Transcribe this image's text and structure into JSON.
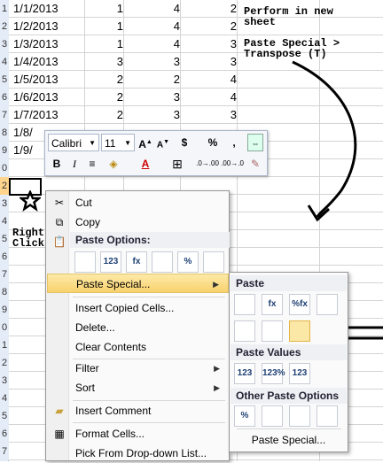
{
  "rows": [
    {
      "num": "1",
      "cells": [
        "1/1/2013",
        "1",
        "4",
        "2"
      ]
    },
    {
      "num": "2",
      "cells": [
        "1/2/2013",
        "1",
        "4",
        "2"
      ]
    },
    {
      "num": "3",
      "cells": [
        "1/3/2013",
        "1",
        "4",
        "3"
      ]
    },
    {
      "num": "4",
      "cells": [
        "1/4/2013",
        "3",
        "3",
        "3"
      ]
    },
    {
      "num": "5",
      "cells": [
        "1/5/2013",
        "2",
        "2",
        "4"
      ]
    },
    {
      "num": "6",
      "cells": [
        "1/6/2013",
        "2",
        "3",
        "4"
      ]
    },
    {
      "num": "7",
      "cells": [
        "1/7/2013",
        "2",
        "3",
        "3"
      ]
    },
    {
      "num": "8",
      "cells": [
        "1/8/",
        "",
        "",
        ""
      ]
    },
    {
      "num": "9",
      "cells": [
        "1/9/",
        "",
        "",
        ""
      ]
    },
    {
      "num": "0",
      "cells": [
        "",
        "",
        "",
        ""
      ]
    },
    {
      "num": "2",
      "cells": [
        "",
        "",
        "",
        ""
      ]
    },
    {
      "num": "3",
      "cells": [
        "",
        "",
        "",
        ""
      ]
    },
    {
      "num": "4",
      "cells": [
        "",
        "",
        "",
        ""
      ]
    },
    {
      "num": "5",
      "cells": [
        "",
        "",
        "",
        ""
      ]
    },
    {
      "num": "6",
      "cells": [
        "",
        "",
        "",
        ""
      ]
    },
    {
      "num": "7",
      "cells": [
        "",
        "",
        "",
        ""
      ]
    },
    {
      "num": "8",
      "cells": [
        "",
        "",
        "",
        ""
      ]
    },
    {
      "num": "9",
      "cells": [
        "",
        "",
        "",
        ""
      ]
    },
    {
      "num": "0",
      "cells": [
        "",
        "",
        "",
        ""
      ]
    },
    {
      "num": "1",
      "cells": [
        "",
        "",
        "",
        ""
      ]
    },
    {
      "num": "2",
      "cells": [
        "",
        "",
        "",
        ""
      ]
    },
    {
      "num": "3",
      "cells": [
        "",
        "",
        "",
        ""
      ]
    },
    {
      "num": "4",
      "cells": [
        "",
        "",
        "",
        ""
      ]
    },
    {
      "num": "5",
      "cells": [
        "",
        "",
        "",
        ""
      ]
    },
    {
      "num": "6",
      "cells": [
        "",
        "",
        "",
        ""
      ]
    },
    {
      "num": "7",
      "cells": [
        "",
        "",
        "",
        ""
      ]
    }
  ],
  "notes": {
    "perform": "Perform in new\nsheet",
    "paste_special": "Paste Special >\nTranspose (T)",
    "right_click": "Right\nClick"
  },
  "mini_toolbar": {
    "font_name": "Calibri",
    "font_size": "11",
    "grow_font": "A",
    "shrink_font": "A",
    "currency": "$",
    "percent": "%",
    "comma": ",",
    "bold": "B",
    "italic": "I",
    "font_color": "A",
    "increase_decimal": ".0→.00",
    "decrease_decimal": ".00→.0"
  },
  "context_menu": {
    "cut": "Cut",
    "copy": "Copy",
    "paste_options_header": "Paste Options:",
    "paste_special": "Paste Special...",
    "insert_copied_cells": "Insert Copied Cells...",
    "delete": "Delete...",
    "clear_contents": "Clear Contents",
    "filter": "Filter",
    "sort": "Sort",
    "insert_comment": "Insert Comment",
    "format_cells": "Format Cells...",
    "pick_from_dropdown": "Pick From Drop-down List...",
    "paste_option_icons": [
      "",
      "123",
      "fx",
      "",
      "%",
      ""
    ]
  },
  "submenu": {
    "paste_header": "Paste",
    "paste_values_header": "Paste Values",
    "other_paste_header": "Other Paste Options",
    "paste_icons_row1": [
      "",
      "fx",
      "%fx",
      ""
    ],
    "paste_icons_row2": [
      "",
      "",
      ""
    ],
    "values_icons": [
      "123",
      "123%",
      "123"
    ],
    "other_icons": [
      "%",
      "",
      "",
      ""
    ],
    "paste_special_link": "Paste Special..."
  },
  "colors": {
    "highlight": "#f8d26e",
    "header_bg": "#e4ecf7",
    "selected_row": "#ffd58d"
  }
}
